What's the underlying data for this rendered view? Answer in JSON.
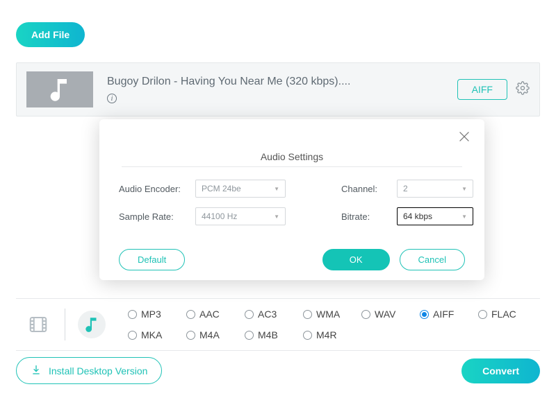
{
  "toolbar": {
    "add_file": "Add File"
  },
  "file": {
    "title": "Bugoy Drilon - Having You Near Me (320 kbps)....",
    "format_badge": "AIFF"
  },
  "modal": {
    "title": "Audio Settings",
    "labels": {
      "encoder": "Audio Encoder:",
      "sample_rate": "Sample Rate:",
      "channel": "Channel:",
      "bitrate": "Bitrate:"
    },
    "values": {
      "encoder": "PCM 24be",
      "sample_rate": "44100 Hz",
      "channel": "2",
      "bitrate": "64 kbps"
    },
    "buttons": {
      "default": "Default",
      "ok": "OK",
      "cancel": "Cancel"
    }
  },
  "formats": {
    "row1": [
      "MP3",
      "AAC",
      "AC3",
      "WMA",
      "WAV",
      "AIFF",
      "FLAC"
    ],
    "row2": [
      "MKA",
      "M4A",
      "M4B",
      "M4R"
    ],
    "selected": "AIFF"
  },
  "footer": {
    "install": "Install Desktop Version",
    "convert": "Convert"
  }
}
